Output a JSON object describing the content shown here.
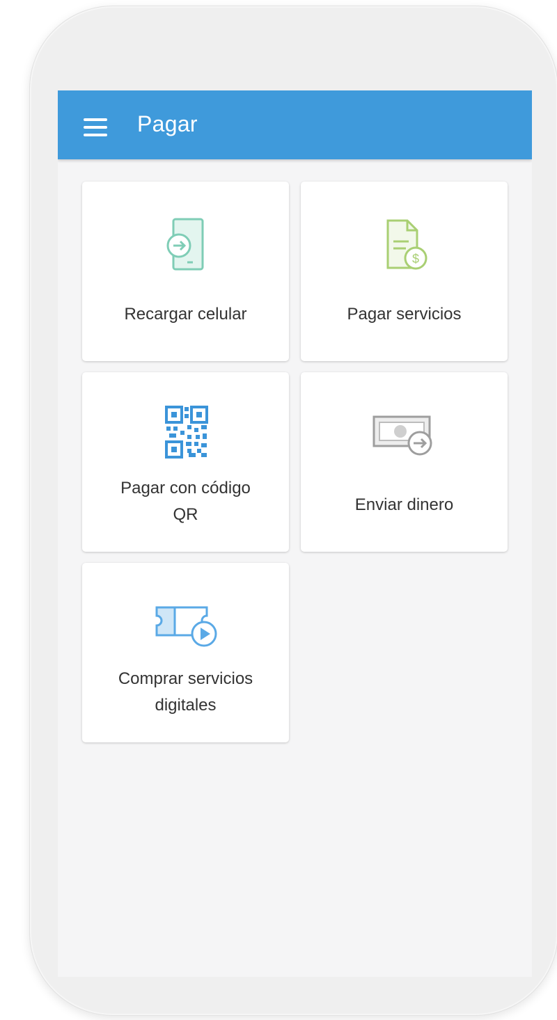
{
  "appbar": {
    "title": "Pagar",
    "menu_icon": "hamburger-menu-icon",
    "color": "#3f9adb"
  },
  "tiles": [
    {
      "label": "Recargar celular",
      "icon": "phone-recharge-icon",
      "color": "#7fcdb6"
    },
    {
      "label": "Pagar servicios",
      "icon": "bill-dollar-icon",
      "color": "#a9cf73"
    },
    {
      "label": "Pagar con código QR",
      "label_line1": "Pagar con código",
      "label_line2": "QR",
      "icon": "qr-code-icon",
      "color": "#3b94d9"
    },
    {
      "label": "Enviar dinero",
      "icon": "money-transfer-icon",
      "color": "#9e9e9e"
    },
    {
      "label": "Comprar servicios digitales",
      "label_line1": "Comprar servicios",
      "label_line2": "digitales",
      "icon": "digital-ticket-icon",
      "color": "#5aa9e6"
    }
  ]
}
